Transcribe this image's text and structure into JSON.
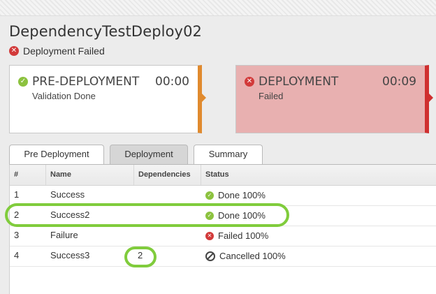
{
  "page": {
    "title": "DependencyTestDeploy02",
    "status": "Deployment Failed"
  },
  "stages": [
    {
      "name": "PRE-DEPLOYMENT",
      "time": "00:00",
      "detail": "Validation Done",
      "state": "done",
      "accent": "#e08a2e"
    },
    {
      "name": "DEPLOYMENT",
      "time": "00:09",
      "detail": "Failed",
      "state": "failed",
      "accent": "#cf2f2f"
    }
  ],
  "tabs": [
    {
      "label": "Pre Deployment",
      "active": false
    },
    {
      "label": "Deployment",
      "active": true
    },
    {
      "label": "Summary",
      "active": false
    }
  ],
  "table": {
    "columns": [
      "#",
      "Name",
      "Dependencies",
      "Status"
    ],
    "rows": [
      {
        "num": "1",
        "name": "Success",
        "dependencies": "",
        "status": "Done 100%",
        "icon": "check-icon"
      },
      {
        "num": "2",
        "name": "Success2",
        "dependencies": "",
        "status": "Done 100%",
        "icon": "check-icon"
      },
      {
        "num": "3",
        "name": "Failure",
        "dependencies": "",
        "status": "Failed 100%",
        "icon": "error-icon"
      },
      {
        "num": "4",
        "name": "Success3",
        "dependencies": "2",
        "status": "Cancelled 100%",
        "icon": "cancel-icon"
      }
    ]
  },
  "colors": {
    "success": "#8cc23f",
    "error": "#d23a3a",
    "highlight": "#80cc3c"
  }
}
